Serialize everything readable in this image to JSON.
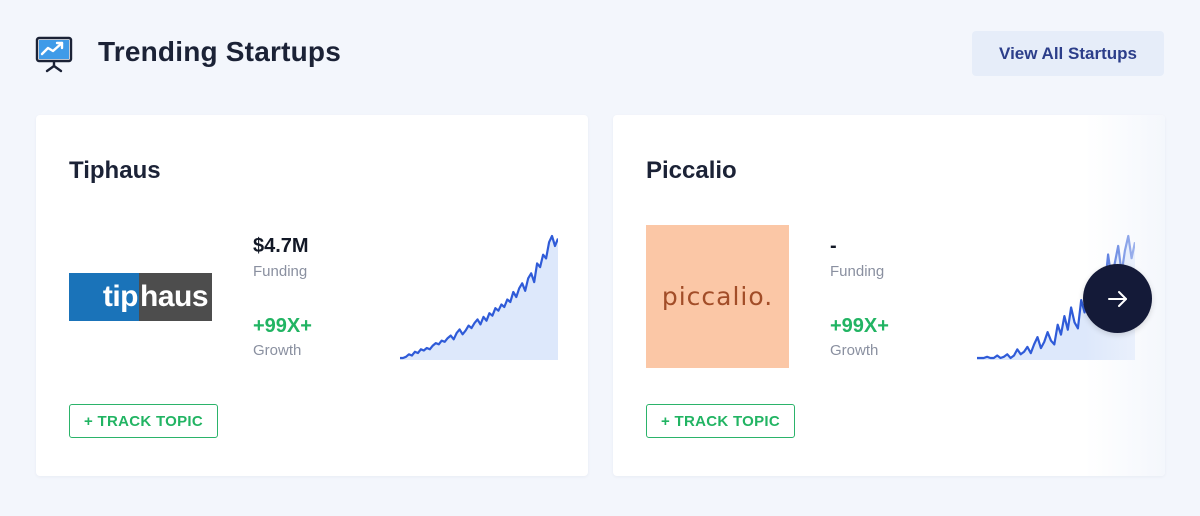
{
  "header": {
    "title": "Trending Startups",
    "icon": "presentation-chart-icon",
    "view_all_label": "View All Startups"
  },
  "cards": [
    {
      "name": "Tiphaus",
      "logo_text": {
        "left": "tip",
        "right": "haus"
      },
      "logo_colors": {
        "left_bg": "#1a73b9",
        "right_bg": "#4d4d4d"
      },
      "funding_value": "$4.7M",
      "funding_label": "Funding",
      "growth_value": "+99X+",
      "growth_label": "Growth",
      "track_label": "+ TRACK TOPIC",
      "trend": [
        2,
        2,
        3,
        5,
        4,
        7,
        6,
        9,
        8,
        10,
        9,
        12,
        14,
        13,
        16,
        15,
        18,
        20,
        17,
        22,
        25,
        21,
        24,
        28,
        26,
        30,
        33,
        29,
        35,
        32,
        38,
        36,
        42,
        40,
        45,
        43,
        49,
        47,
        55,
        51,
        58,
        62,
        56,
        66,
        70,
        63,
        78,
        75,
        85,
        82,
        95,
        100,
        92,
        98
      ]
    },
    {
      "name": "Piccalio",
      "logo_text": "piccalio.",
      "logo_colors": {
        "bg": "#fbc7a6",
        "text": "#a24d28"
      },
      "funding_value": "-",
      "funding_label": "Funding",
      "growth_value": "+99X+",
      "growth_label": "Growth",
      "track_label": "+ TRACK TOPIC",
      "trend": [
        1,
        1,
        1,
        2,
        1,
        1,
        3,
        1,
        2,
        4,
        1,
        3,
        8,
        4,
        6,
        10,
        5,
        12,
        18,
        9,
        14,
        22,
        15,
        12,
        28,
        20,
        35,
        24,
        42,
        30,
        25,
        48,
        38,
        55,
        45,
        60,
        52,
        70,
        58,
        85,
        65,
        78,
        92,
        70,
        88,
        100,
        82,
        95
      ]
    }
  ],
  "next_button": {
    "icon": "arrow-right-icon"
  },
  "colors": {
    "accent_green": "#22b463",
    "spark_line": "#2f5bd8",
    "spark_fill": "#dde8fb",
    "next_bg": "#141a38"
  }
}
